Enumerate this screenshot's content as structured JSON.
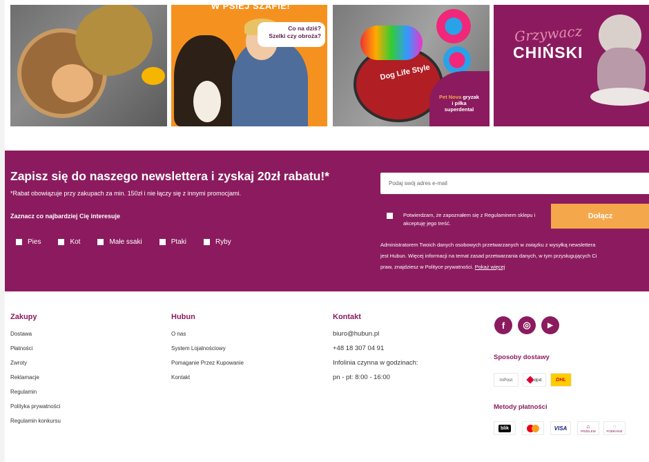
{
  "banners": [
    {
      "name": "toys-banner"
    },
    {
      "name": "harness-banner",
      "heading": "W PSIEJ SZAFIE!",
      "bubble_line1": "Co na dziś?",
      "bubble_line2": "Szelki czy obroża?"
    },
    {
      "name": "dental-toy-banner",
      "brand": "Dog Life Style",
      "promo_highlight": "Pet Nova",
      "promo_text1": "gryzak",
      "promo_text2": "i piłka",
      "promo_text3": "superdental"
    },
    {
      "name": "breed-banner",
      "script": "Grzywacz",
      "title": "CHIŃSKI"
    }
  ],
  "newsletter": {
    "title": "Zapisz się do naszego newslettera i zyskaj 20zł rabatu!*",
    "note": "*Rabat obowiązuje przy zakupach za min. 150zł i nie łączy się z innymi promocjami.",
    "interest_label": "Zaznacz co najbardziej Cię interesuje",
    "options": [
      "Pies",
      "Kot",
      "Małe ssaki",
      "Ptaki",
      "Ryby"
    ],
    "email_placeholder": "Podaj swój adres e-mail",
    "consent_text": "Potwierdzam, że zapoznałem się z Regulaminem sklepu i akceptuję jego treść.",
    "join_label": "Dołącz",
    "admin_line1": "Administratorem Twoich danych osobowych przetwarzanych w związku z wysyłką newslettera",
    "admin_line2": "jest Hubun. Więcej informacji na temat zasad przetwarzania danych, w tym przysługujących Ci",
    "admin_line3": "praw, znajdziesz w Polityce prywatności.",
    "admin_link": "Pokaż więcej",
    "bg_color": "#8b1b5e",
    "accent_color": "#f5a74b"
  },
  "footer": {
    "zakupy": {
      "title": "Zakupy",
      "links": [
        "Dostawa",
        "Płatności",
        "Zwroty",
        "Reklamacje",
        "Regulamin",
        "Polityka prywatności",
        "Regulamin konkursu"
      ]
    },
    "hubun": {
      "title": "Hubun",
      "links": [
        "O nas",
        "System Lojalnościowy",
        "Pomaganie Przez Kupowanie",
        "Kontakt"
      ]
    },
    "kontakt": {
      "title": "Kontakt",
      "email": "biuro@hubun.pl",
      "phone": "+48 18 307 04 91",
      "hours_label": "Infolinia czynna w godzinach:",
      "hours": "pn - pt: 8:00 - 16:00"
    },
    "social": [
      {
        "icon": "facebook-icon",
        "glyph": "f"
      },
      {
        "icon": "instagram-icon",
        "glyph": "◎"
      },
      {
        "icon": "youtube-icon",
        "glyph": "▶"
      }
    ],
    "shipping_title": "Sposoby dostawy",
    "shipping": [
      "InPost",
      "dpd",
      "DHL"
    ],
    "payment_title": "Metody płatności",
    "payments": [
      "blik",
      "mastercard",
      "VISA",
      "PRZELEW",
      "POBRANIE"
    ]
  }
}
